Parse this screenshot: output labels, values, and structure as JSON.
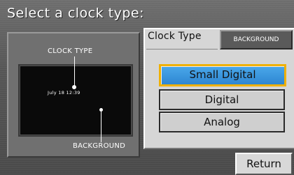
{
  "header": {
    "title": "Select a clock type:"
  },
  "preview": {
    "clock_type_label": "CLOCK TYPE",
    "background_label": "BACKGROUND",
    "screen_time": "July 18  12:39"
  },
  "tabs": {
    "clock_type": "Clock Type",
    "background": "BACKGROUND"
  },
  "options": [
    {
      "label": "Small Digital",
      "selected": true
    },
    {
      "label": "Digital",
      "selected": false
    },
    {
      "label": "Analog",
      "selected": false
    }
  ],
  "footer": {
    "return_label": "Return"
  },
  "colors": {
    "selected_fill": "#2e86d2",
    "selected_border": "#f0b000"
  }
}
